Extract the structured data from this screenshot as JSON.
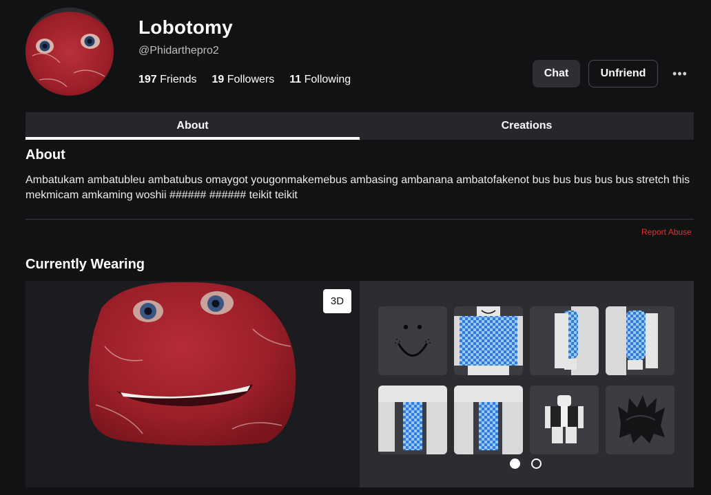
{
  "profile": {
    "display_name": "Lobotomy",
    "username": "@Phidarthepro2",
    "friends_count": "197",
    "friends_label": "Friends",
    "followers_count": "19",
    "followers_label": "Followers",
    "following_count": "11",
    "following_label": "Following"
  },
  "actions": {
    "chat_label": "Chat",
    "unfriend_label": "Unfriend",
    "more_label": "•••"
  },
  "tabs": [
    {
      "label": "About",
      "active": true
    },
    {
      "label": "Creations",
      "active": false
    }
  ],
  "about": {
    "title": "About",
    "text": "Ambatukam ambatubleu ambatubus omaygot yougonmakemebus ambasing ambanana ambatofakenot bus bus bus bus bus stretch this mekmicam amkaming woshii ###### ###### teikit teikit",
    "report_label": "Report Abuse"
  },
  "wearing": {
    "title": "Currently Wearing",
    "toggle_3d_label": "3D",
    "items": [
      {
        "name": "smiley-face"
      },
      {
        "name": "blue-checkered-shirt"
      },
      {
        "name": "right-arm-sleeve"
      },
      {
        "name": "left-arm-sleeve"
      },
      {
        "name": "right-leg-pants"
      },
      {
        "name": "left-leg-pants"
      },
      {
        "name": "tuxedo-outfit"
      },
      {
        "name": "black-spiky-hair"
      }
    ],
    "pages": 2,
    "current_page": 1
  },
  "colors": {
    "background": "#111214",
    "tab_bar": "#25272b",
    "item_tile": "#3b3d42",
    "report": "#e5312b",
    "meat_red": "#a5202c",
    "check_blue": "#2f7ce0"
  }
}
